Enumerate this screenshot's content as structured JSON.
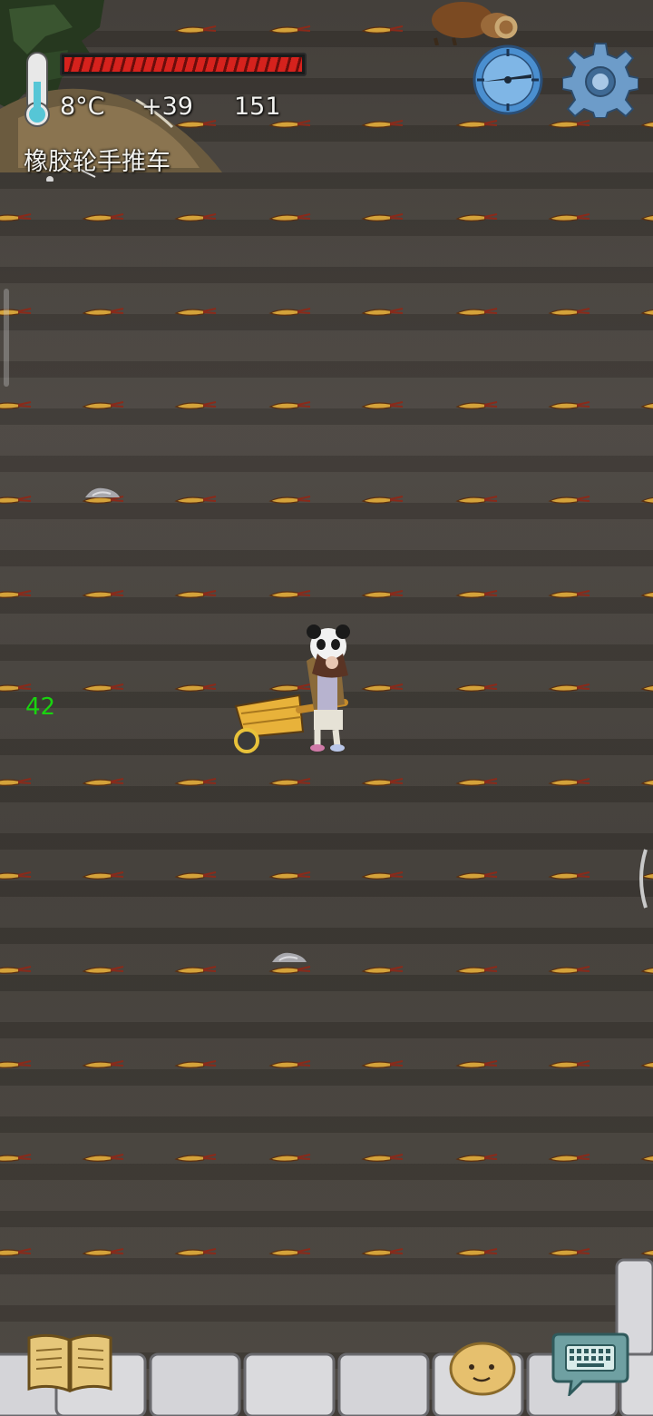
{
  "hud": {
    "temperature": "8°C",
    "bonus": "+39",
    "count": "151",
    "held_item": "橡胶轮手推车",
    "health_fraction": 1.0
  },
  "world": {
    "floating_number": "42"
  },
  "icons": {
    "thermometer": "thermometer-icon",
    "compass": "compass-icon",
    "settings": "gear-icon",
    "recipe_book": "book-icon",
    "emote": "emote-face-icon",
    "keyboard": "keyboard-icon"
  },
  "colors": {
    "health": "#d6221d",
    "floating_number": "#19d40f",
    "soil": "#433f39"
  }
}
